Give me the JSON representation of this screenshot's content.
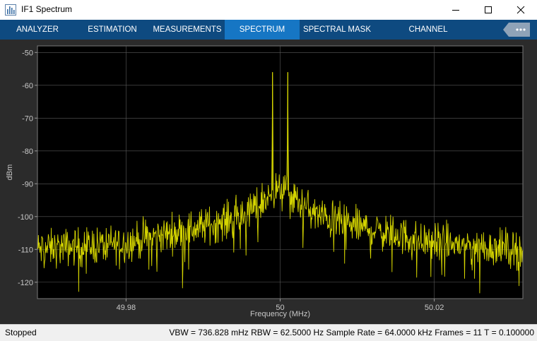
{
  "window": {
    "title": "IF1 Spectrum",
    "controls": [
      "minimize-icon",
      "maximize-icon",
      "close-icon"
    ]
  },
  "toolstrip": {
    "tabs": [
      {
        "label": "ANALYZER",
        "active": false
      },
      {
        "label": "ESTIMATION",
        "active": false
      },
      {
        "label": "MEASUREMENTS",
        "active": false
      },
      {
        "label": "SPECTRUM",
        "active": true
      },
      {
        "label": "SPECTRAL MASK",
        "active": false
      },
      {
        "label": "CHANNEL MEASUREMENTS",
        "active": false
      }
    ],
    "more_icon": "ellipsis-icon"
  },
  "chart_data": {
    "type": "line",
    "title": "",
    "xlabel": "Frequency (MHz)",
    "ylabel": "dBm",
    "xlim": [
      49.9685,
      50.0315
    ],
    "ylim": [
      -125,
      -48
    ],
    "xticks": [
      49.98,
      50,
      50.02
    ],
    "xtick_labels": [
      "49.98",
      "50",
      "50.02"
    ],
    "yticks": [
      -50,
      -60,
      -70,
      -80,
      -90,
      -100,
      -110,
      -120
    ],
    "ytick_labels": [
      "-50",
      "-60",
      "-70",
      "-80",
      "-90",
      "-100",
      "-110",
      "-120"
    ],
    "grid": true,
    "colors": {
      "background": "#000000",
      "frame": "#2b2b2b",
      "trace": "#d6d600",
      "grid": "#5a5a5a",
      "text": "#c8c8c8"
    },
    "series": [
      {
        "noise_floor_profile": {
          "x": [
            49.9685,
            49.98,
            49.99,
            49.995,
            49.998,
            50,
            50.002,
            50.005,
            50.01,
            50.02,
            50.0315
          ],
          "y": [
            -110,
            -108,
            -103,
            -100,
            -95,
            -92,
            -95,
            -100,
            -103,
            -108,
            -110
          ]
        },
        "noise_spread_db": 5,
        "peaks": [
          {
            "x": 49.999,
            "y": -56
          },
          {
            "x": 50.001,
            "y": -56
          }
        ]
      }
    ]
  },
  "status": {
    "state": "Stopped",
    "details": "VBW = 736.828 mHz  RBW = 62.5000 Hz  Sample Rate = 64.0000 kHz  Frames = 11  T = 0.100000"
  }
}
